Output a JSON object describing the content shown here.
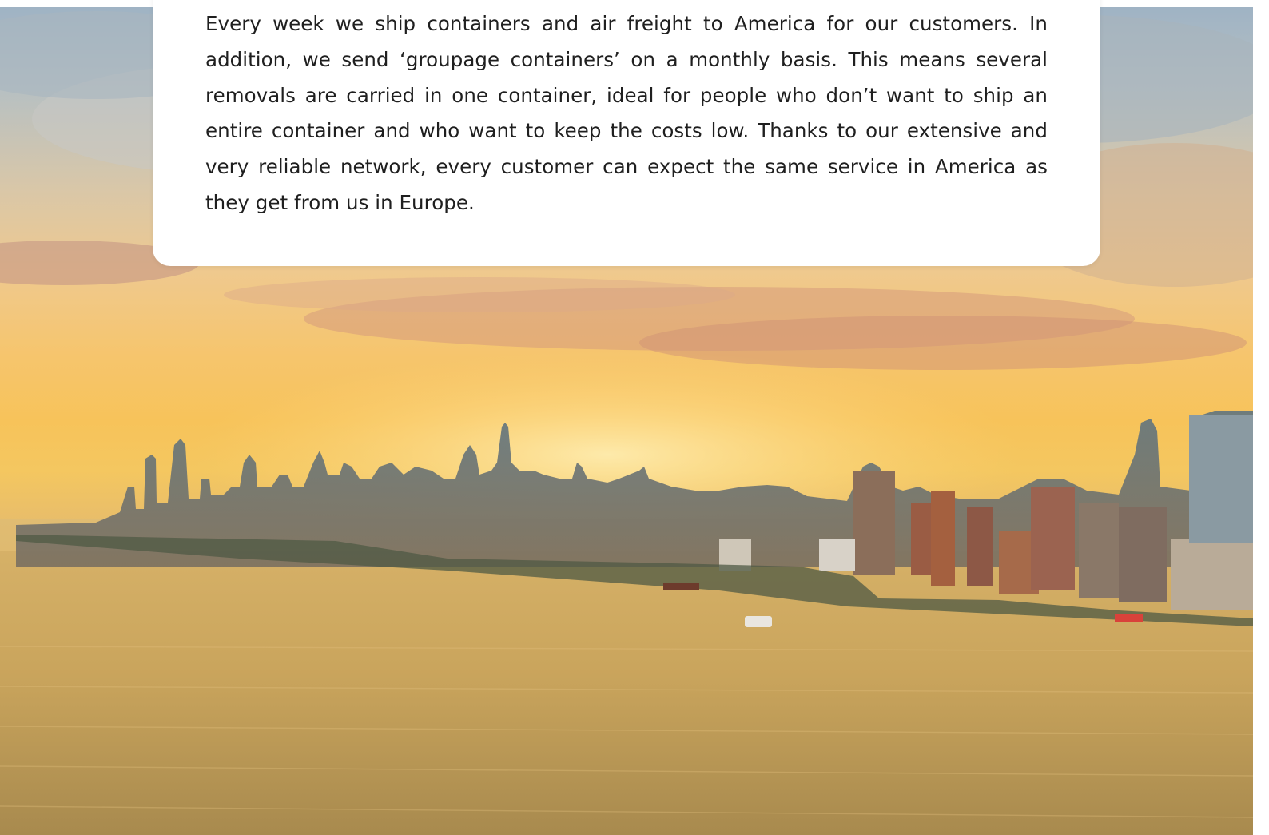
{
  "content": {
    "paragraph": "Every week we ship containers and air freight to America for our customers. In addition, we send ‘groupage containers’ on a monthly basis. This means several removals are carried in one container, ideal for people who don’t want to ship an entire container and who want to keep the costs low.  Thanks to our extensive and very reliable network, every customer can expect the same service in America as they get from us in Europe."
  },
  "hero": {
    "image": "new-york-skyline-at-sunset-photo"
  },
  "colors": {
    "card_background": "#ffffff",
    "text": "#1f1f1f",
    "sky_top": "#9fb3c4",
    "sky_glow": "#f7c35a",
    "water": "#c49b57"
  }
}
